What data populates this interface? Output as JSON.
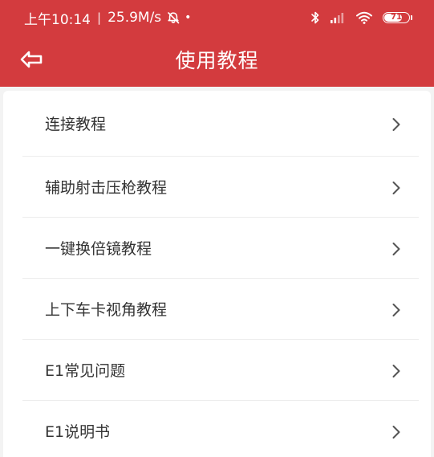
{
  "status_bar": {
    "time": "上午10:14",
    "separator": "|",
    "network_speed": "25.9M/s",
    "dot": "•",
    "battery_level": "71",
    "icons": [
      "alarm-off-icon",
      "bluetooth-icon",
      "cellular-signal-icon",
      "wifi-icon",
      "battery-icon"
    ]
  },
  "header": {
    "title": "使用教程",
    "back_icon": "back-arrow-icon",
    "background_color": "#d33b3e"
  },
  "menu": {
    "items": [
      {
        "label": "连接教程"
      },
      {
        "label": "辅助射击压枪教程"
      },
      {
        "label": "一键换倍镜教程"
      },
      {
        "label": "上下车卡视角教程"
      },
      {
        "label": "E1常见问题"
      },
      {
        "label": "E1说明书"
      }
    ],
    "chevron_icon": "chevron-right-icon"
  }
}
